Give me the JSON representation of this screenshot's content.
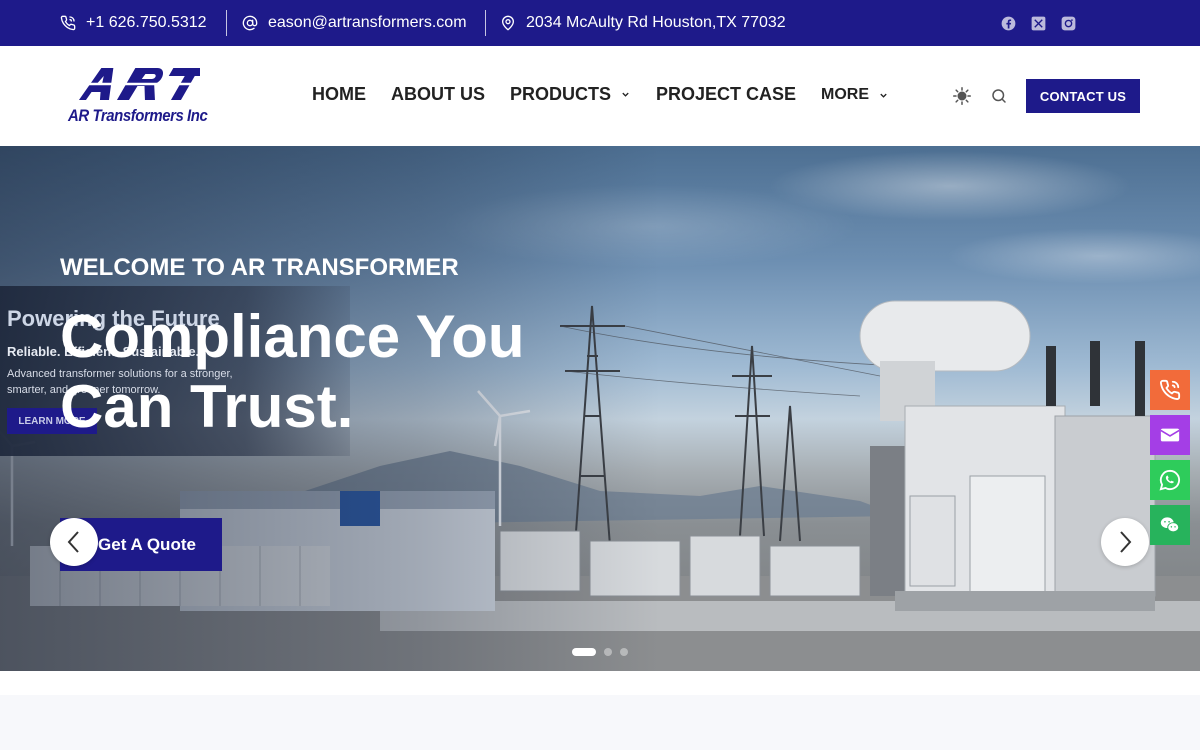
{
  "topbar": {
    "phone": "+1 626.750.5312",
    "email": "eason@artransformers.com",
    "address": "2034 McAulty Rd Houston,TX 77032",
    "social": [
      "facebook-icon",
      "x-twitter-icon",
      "instagram-icon"
    ]
  },
  "header": {
    "logo_mark": "ART",
    "logo_text": "AR Transformers Inc",
    "nav": [
      {
        "label": "HOME"
      },
      {
        "label": "ABOUT US"
      },
      {
        "label": "PRODUCTS",
        "has_dropdown": true
      },
      {
        "label": "PROJECT CASE"
      },
      {
        "label": "MORE",
        "has_dropdown": true
      }
    ],
    "icons": [
      "theme-toggle-icon",
      "search-icon"
    ],
    "contact_label": "CONTACT US"
  },
  "hero": {
    "inset": {
      "title": "Powering the Future",
      "subtitle": "Reliable. Efficient. Sustainable.",
      "body": "Advanced transformer solutions for a stronger, smarter, and greener tomorrow.",
      "cta": "LEARN MORE"
    },
    "eyebrow": "WELCOME TO AR TRANSFORMER",
    "headline": "Compliance You Can Trust.",
    "cta": "Get A Quote",
    "slides_total": 3,
    "slide_active": 1
  },
  "float_contact": [
    {
      "icon": "phone-icon",
      "color": "#f26b3a"
    },
    {
      "icon": "mail-icon",
      "color": "#a43ee6"
    },
    {
      "icon": "whatsapp-icon",
      "color": "#2ecc5b"
    },
    {
      "icon": "wechat-icon",
      "color": "#27b35c"
    }
  ],
  "colors": {
    "brand": "#1e1a8a",
    "text_dark": "#222222"
  }
}
